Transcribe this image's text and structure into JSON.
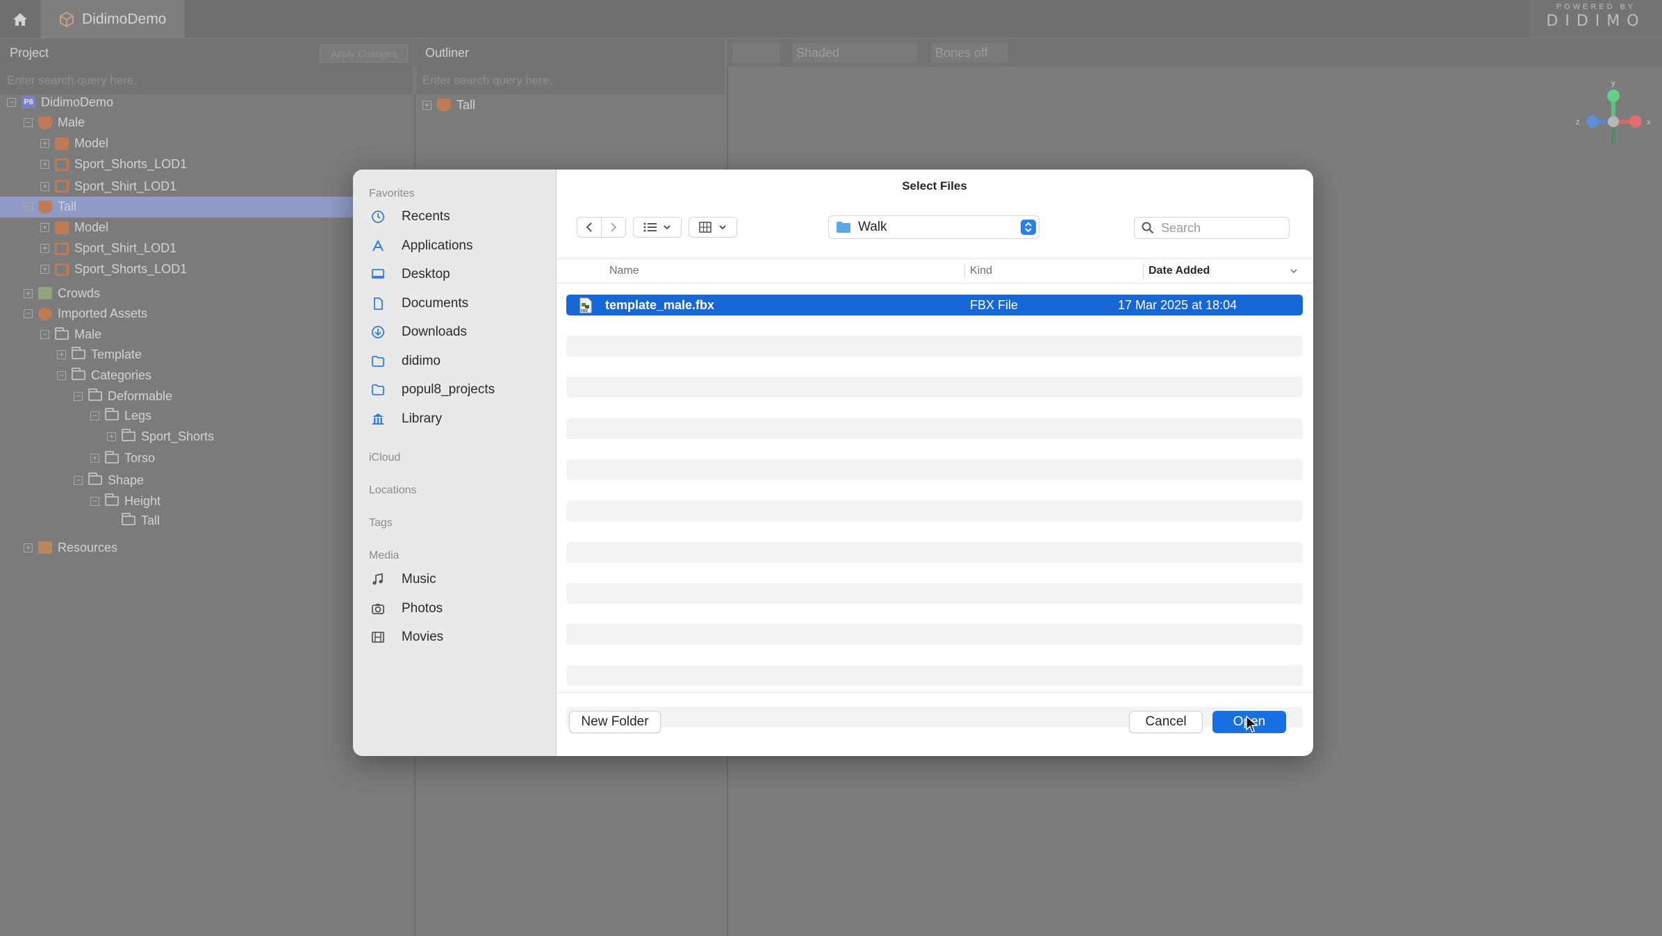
{
  "app": {
    "tab_title": "DidimoDemo",
    "logo_powered": "POWERED BY",
    "logo_name": "DIDIMO"
  },
  "project": {
    "header": "Project",
    "apply_changes": "Apply Changes",
    "search_placeholder": "Enter search query here.",
    "tree": [
      {
        "label": "DidimoDemo",
        "icon": "p8-icon",
        "exp": "−"
      },
      {
        "label": "Male",
        "icon": "person-icon",
        "exp": "−"
      },
      {
        "label": "Model",
        "icon": "mesh-icon",
        "exp": "+"
      },
      {
        "label": "Sport_Shorts_LOD1",
        "icon": "garment-icon",
        "exp": "+"
      },
      {
        "label": "Sport_Shirt_LOD1",
        "icon": "garment-icon",
        "exp": "+"
      },
      {
        "label": "Tall",
        "icon": "person-icon",
        "exp": "−",
        "selected": true
      },
      {
        "label": "Model",
        "icon": "mesh-icon",
        "exp": "+"
      },
      {
        "label": "Sport_Shirt_LOD1",
        "icon": "garment-icon",
        "exp": "+"
      },
      {
        "label": "Sport_Shorts_LOD1",
        "icon": "garment-icon",
        "exp": "+"
      },
      {
        "label": "Crowds",
        "icon": "crowd-icon",
        "exp": "+"
      },
      {
        "label": "Imported Assets",
        "icon": "assets-icon",
        "exp": "−"
      },
      {
        "label": "Male",
        "icon": "folder-icon",
        "exp": "−"
      },
      {
        "label": "Template",
        "icon": "folder-icon",
        "exp": "+"
      },
      {
        "label": "Categories",
        "icon": "folder-icon",
        "exp": "−"
      },
      {
        "label": "Deformable",
        "icon": "folder-icon",
        "exp": "−"
      },
      {
        "label": "Legs",
        "icon": "folder-icon",
        "exp": "−"
      },
      {
        "label": "Sport_Shorts",
        "icon": "folder-icon",
        "exp": "+"
      },
      {
        "label": "Torso",
        "icon": "folder-icon",
        "exp": "+"
      },
      {
        "label": "Shape",
        "icon": "folder-icon",
        "exp": "−"
      },
      {
        "label": "Height",
        "icon": "folder-icon",
        "exp": "−"
      },
      {
        "label": "Tall",
        "icon": "folder-icon",
        "exp": ""
      },
      {
        "label": "Resources",
        "icon": "resources-icon",
        "exp": "+"
      }
    ]
  },
  "outliner": {
    "header": "Outliner",
    "search_placeholder": "Enter search query here.",
    "item": "Tall"
  },
  "viewport": {
    "shading": "Shaded",
    "bones": "Bones off",
    "gizmo": {
      "x": "x",
      "y": "y",
      "z": "z"
    }
  },
  "dialog": {
    "title": "Select Files",
    "sidebar": {
      "favorites_label": "Favorites",
      "favorites": [
        {
          "label": "Recents",
          "icon": "clock-icon"
        },
        {
          "label": "Applications",
          "icon": "applications-icon"
        },
        {
          "label": "Desktop",
          "icon": "desktop-icon"
        },
        {
          "label": "Documents",
          "icon": "document-icon"
        },
        {
          "label": "Downloads",
          "icon": "download-icon"
        },
        {
          "label": "didimo",
          "icon": "folder-icon"
        },
        {
          "label": "popul8_projects",
          "icon": "folder-icon"
        },
        {
          "label": "Library",
          "icon": "library-icon"
        }
      ],
      "icloud_label": "iCloud",
      "locations_label": "Locations",
      "tags_label": "Tags",
      "media_label": "Media",
      "media": [
        {
          "label": "Music",
          "icon": "music-icon"
        },
        {
          "label": "Photos",
          "icon": "camera-icon"
        },
        {
          "label": "Movies",
          "icon": "film-icon"
        }
      ]
    },
    "location": "Walk",
    "search_placeholder": "Search",
    "columns": {
      "name": "Name",
      "kind": "Kind",
      "date_added": "Date Added"
    },
    "files": [
      {
        "name": "template_male.fbx",
        "kind": "FBX File",
        "date_added": "17 Mar 2025 at 18:04",
        "selected": true
      }
    ],
    "new_folder": "New Folder",
    "cancel": "Cancel",
    "open": "Open"
  },
  "colors": {
    "accent": "#1766d6",
    "selection_bg": "#8f9bc6"
  }
}
